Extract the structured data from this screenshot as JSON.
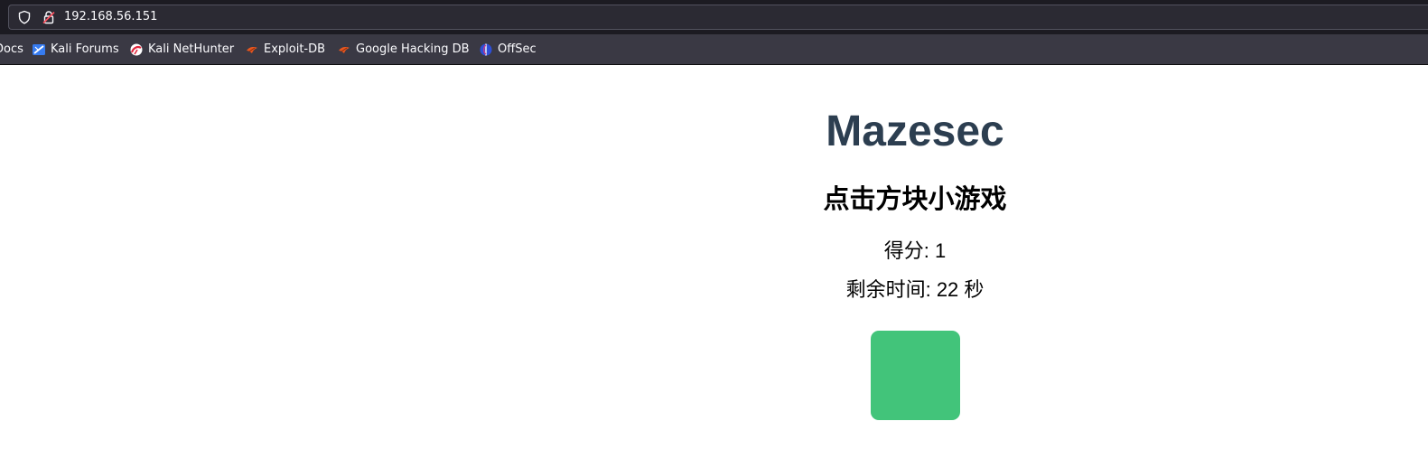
{
  "browser": {
    "url": "192.168.56.151",
    "bookmarks": [
      {
        "label": "Docs",
        "icon": "kali-docs-icon"
      },
      {
        "label": "Kali Forums",
        "icon": "kali-forums-icon"
      },
      {
        "label": "Kali NetHunter",
        "icon": "kali-nethunter-icon"
      },
      {
        "label": "Exploit-DB",
        "icon": "exploit-db-icon"
      },
      {
        "label": "Google Hacking DB",
        "icon": "ghdb-icon"
      },
      {
        "label": "OffSec",
        "icon": "offsec-icon"
      }
    ]
  },
  "page": {
    "site_title": "Mazesec",
    "game_title": "点击方块小游戏",
    "score_label": "得分: ",
    "score_value": "1",
    "time_label": "剩余时间: ",
    "time_value": "22",
    "time_unit": " 秒",
    "box_color": "#42c47a"
  },
  "colors": {
    "title": "#2c3e50",
    "chrome_bg": "#2b2a33",
    "box": "#42c47a"
  }
}
